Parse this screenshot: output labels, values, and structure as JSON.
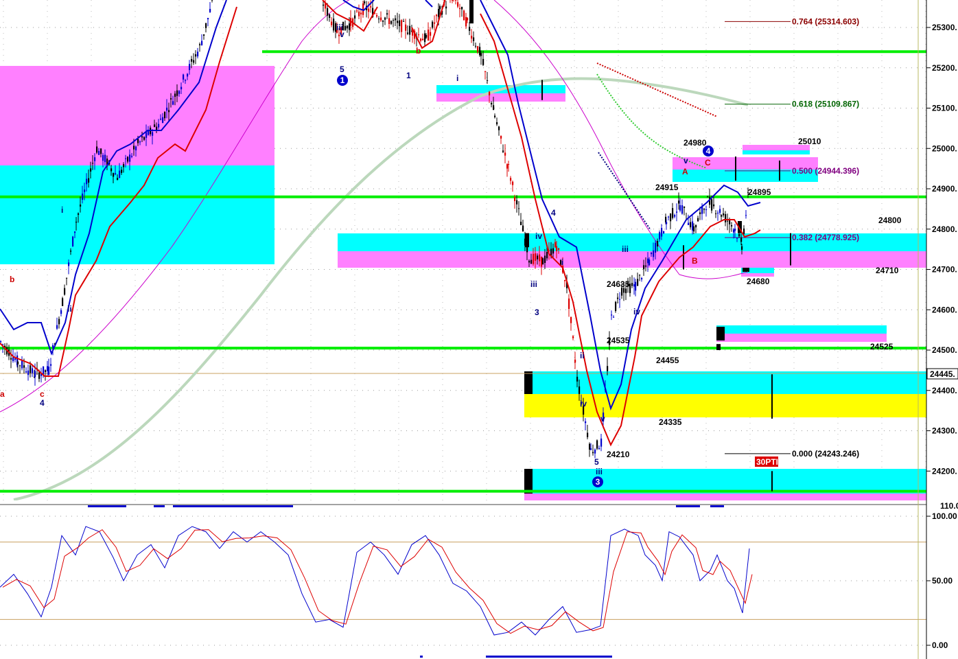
{
  "chart_data": {
    "type": "candlestick",
    "price_axis": {
      "ticks": [
        "25300.",
        "25200.",
        "25100.",
        "25000.",
        "24900.",
        "24800.",
        "24700.",
        "24600.",
        "24500.",
        "24400.",
        "24300.",
        "24200."
      ],
      "tick_values": [
        25300,
        25200,
        25100,
        25000,
        24900,
        24800,
        24700,
        24600,
        24500,
        24400,
        24300,
        24200
      ],
      "current_price": "24445.",
      "range": [
        24140,
        25365
      ]
    },
    "oscillator_axis": {
      "ticks": [
        "100.00",
        "50.00",
        "0.00"
      ],
      "tick_values": [
        100,
        50,
        0
      ],
      "top_label": "110.0",
      "levels": [
        80,
        20
      ]
    },
    "fibonacci": [
      {
        "label": "0.764 (25314.603)",
        "value": 25314.603,
        "color": "#8b0000"
      },
      {
        "label": "0.618 (25109.867)",
        "value": 25109.867,
        "color": "#006400"
      },
      {
        "label": "0.500 (24944.396)",
        "value": 24944.396,
        "color": "#800080"
      },
      {
        "label": "0.382 (24778.925)",
        "value": 24778.925,
        "color": "#800080"
      },
      {
        "label": "0.000 (24243.246)",
        "value": 24243.246,
        "color": "#000000"
      }
    ],
    "horizontal_levels": [
      25240,
      24880,
      24505,
      24150
    ],
    "price_labels": [
      {
        "text": "24980",
        "value": 24980
      },
      {
        "text": "25010",
        "value": 25010
      },
      {
        "text": "24915",
        "value": 24915
      },
      {
        "text": "24895",
        "value": 24895
      },
      {
        "text": "24800",
        "value": 24800
      },
      {
        "text": "24710",
        "value": 24710
      },
      {
        "text": "24680",
        "value": 24680
      },
      {
        "text": "24635",
        "value": 24635
      },
      {
        "text": "24535",
        "value": 24535
      },
      {
        "text": "24525",
        "value": 24525
      },
      {
        "text": "24455",
        "value": 24455
      },
      {
        "text": "24335",
        "value": 24335
      },
      {
        "text": "24210",
        "value": 24210
      }
    ],
    "wave_labels": [
      {
        "text": "iii",
        "color": "#000080"
      },
      {
        "text": "v",
        "color": "#000080"
      },
      {
        "text": "5",
        "color": "#000080"
      },
      {
        "text": "1",
        "color": "#000080"
      },
      {
        "text": "i",
        "color": "#000080"
      },
      {
        "text": "b",
        "color": "#cc0000"
      },
      {
        "text": "4",
        "color": "#000080"
      },
      {
        "text": "iv",
        "color": "#000080"
      },
      {
        "text": "iii",
        "color": "#000080"
      },
      {
        "text": "3",
        "color": "#000080"
      },
      {
        "text": "i",
        "color": "#000080"
      },
      {
        "text": "iv",
        "color": "#000080"
      },
      {
        "text": "iii",
        "color": "#000080"
      },
      {
        "text": "ii",
        "color": "#000080"
      },
      {
        "text": "v",
        "color": "#000080"
      },
      {
        "text": "5",
        "color": "#000080"
      },
      {
        "text": "iii",
        "color": "#000080"
      },
      {
        "text": "iv",
        "color": "#000080"
      },
      {
        "text": "v",
        "color": "#000080"
      },
      {
        "text": "A",
        "color": "#cc0000"
      },
      {
        "text": "B",
        "color": "#cc0000"
      },
      {
        "text": "C",
        "color": "#cc0000"
      },
      {
        "text": "b",
        "color": "#cc0000"
      },
      {
        "text": "c",
        "color": "#cc0000"
      },
      {
        "text": "4",
        "color": "#000080"
      },
      {
        "text": "i",
        "color": "#000080"
      },
      {
        "text": "ii",
        "color": "#000080"
      },
      {
        "text": "a",
        "color": "#cc0000"
      }
    ],
    "circle_labels": [
      "1",
      "3",
      "4"
    ],
    "marker": {
      "text": "30PTI"
    },
    "colors": {
      "cyan": "#00ffff",
      "magenta": "#ff80ff",
      "yellow": "#ffff00",
      "green": "#00ee00",
      "sma": "#bcd8bc"
    }
  }
}
